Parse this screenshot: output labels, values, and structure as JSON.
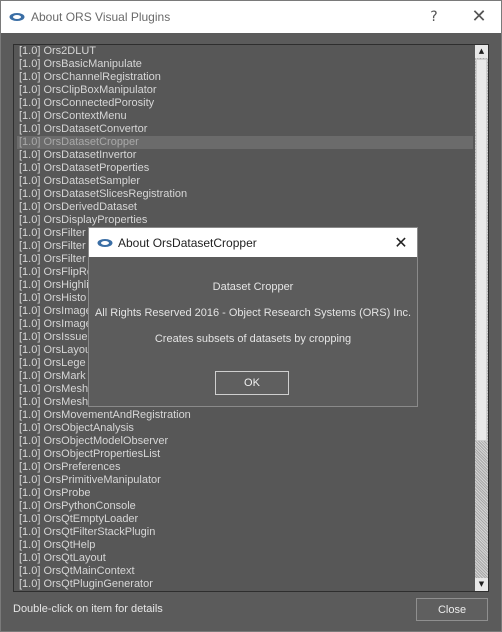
{
  "window": {
    "title": "About ORS Visual Plugins",
    "help_glyph": "?",
    "close_glyph": "✕"
  },
  "plugins": [
    "[1.0] Ors2DLUT",
    "[1.0] OrsBasicManipulate",
    "[1.0] OrsChannelRegistration",
    "[1.0] OrsClipBoxManipulator",
    "[1.0] OrsConnectedPorosity",
    "[1.0] OrsContextMenu",
    "[1.0] OrsDatasetConvertor",
    "[1.0] OrsDatasetCropper",
    "[1.0] OrsDatasetInvertor",
    "[1.0] OrsDatasetProperties",
    "[1.0] OrsDatasetSampler",
    "[1.0] OrsDatasetSlicesRegistration",
    "[1.0] OrsDerivedDataset",
    "[1.0] OrsDisplayProperties",
    "[1.0] OrsFilter",
    "[1.0] OrsFilter",
    "[1.0] OrsFilter",
    "[1.0] OrsFlipRo",
    "[1.0] OrsHighli",
    "[1.0] OrsHisto",
    "[1.0] OrsImage",
    "[1.0] OrsImage",
    "[1.0] OrsIssue",
    "[1.0] OrsLayou",
    "[1.0] OrsLege",
    "[1.0] OrsMark",
    "[1.0] OrsMesh",
    "[1.0] OrsMesh",
    "[1.0] OrsMovementAndRegistration",
    "[1.0] OrsObjectAnalysis",
    "[1.0] OrsObjectModelObserver",
    "[1.0] OrsObjectPropertiesList",
    "[1.0] OrsPreferences",
    "[1.0] OrsPrimitiveManipulator",
    "[1.0] OrsProbe",
    "[1.0] OrsPythonConsole",
    "[1.0] OrsQtEmptyLoader",
    "[1.0] OrsQtFilterStackPlugin",
    "[1.0] OrsQtHelp",
    "[1.0] OrsQtLayout",
    "[1.0] OrsQtMainContext",
    "[1.0] OrsQtPluginGenerator"
  ],
  "selected_index": 7,
  "scrollbar": {
    "up_glyph": "▲",
    "down_glyph": "▼"
  },
  "footer": {
    "hint": "Double-click on item for details",
    "close_label": "Close"
  },
  "modal": {
    "title": "About OrsDatasetCropper",
    "close_glyph": "✕",
    "name": "Dataset Cropper",
    "copyright": "All Rights Reserved 2016 - Object Research Systems (ORS) Inc.",
    "description": "Creates subsets of datasets by cropping",
    "ok_label": "OK"
  }
}
